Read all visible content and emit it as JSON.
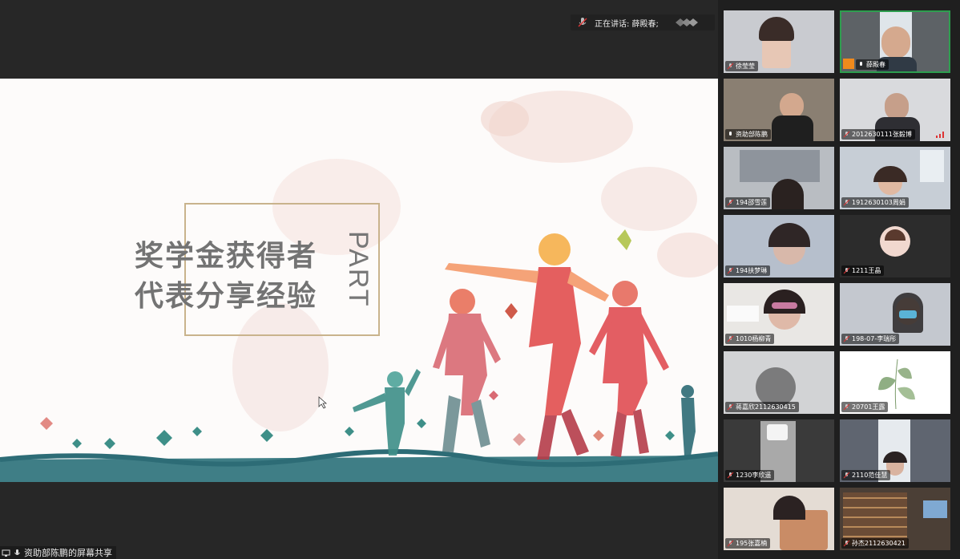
{
  "header": {
    "speaking_label": "正在讲话: 薛殿春;"
  },
  "slide": {
    "title_line1": "奖学金获得者",
    "title_line2": "代表分享经验",
    "part_text": "PART"
  },
  "share": {
    "label": "资助部陈鹏的屏幕共享"
  },
  "participants": [
    {
      "name": "徐莹莹"
    },
    {
      "name": "薛殿春"
    },
    {
      "name": "资助部陈鹏"
    },
    {
      "name": "2012630111张毅博"
    },
    {
      "name": "194邵雪莲"
    },
    {
      "name": "1912630103周娟"
    },
    {
      "name": "194扶梦琳"
    },
    {
      "name": "1211王晶"
    },
    {
      "name": "1010杨柳青"
    },
    {
      "name": "198-07-李瑞彤"
    },
    {
      "name": "蒋嘉欣2112630415"
    },
    {
      "name": "20701王露"
    },
    {
      "name": "1230李欣遥"
    },
    {
      "name": "2110范佳慧"
    },
    {
      "name": "195张嘉楠"
    },
    {
      "name": "孙杰2112630421"
    }
  ],
  "colors": {
    "active_border": "#2e9e4f",
    "frame_gold": "#c9b38c",
    "self_avatar": "#f08a1c"
  }
}
